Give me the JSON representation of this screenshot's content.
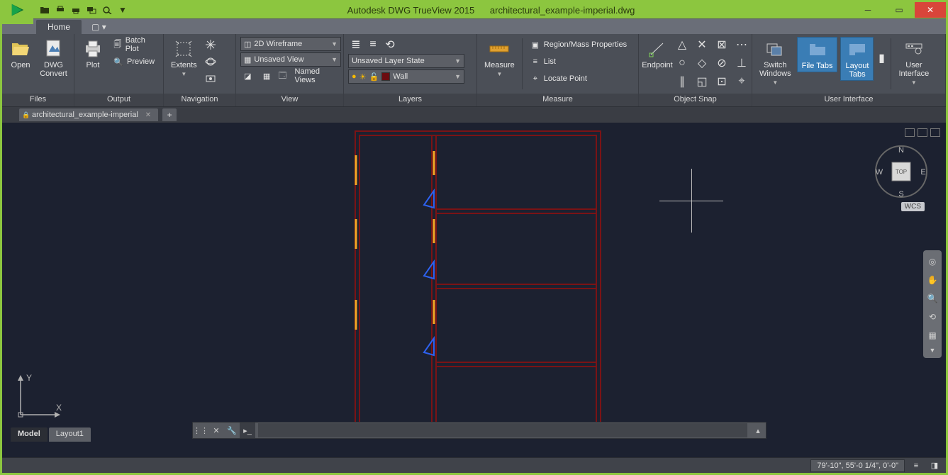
{
  "title": {
    "app": "Autodesk DWG TrueView 2015",
    "document": "architectural_example-imperial.dwg"
  },
  "tabs": {
    "home": "Home"
  },
  "panels": {
    "files": {
      "title": "Files",
      "open": "Open",
      "dwg_convert": "DWG\nConvert"
    },
    "output": {
      "title": "Output",
      "plot": "Plot",
      "batch_plot": "Batch Plot",
      "preview": "Preview"
    },
    "navigation": {
      "title": "Navigation",
      "extents": "Extents"
    },
    "view": {
      "title": "View",
      "visual_style": "2D Wireframe",
      "named_view": "Unsaved View",
      "named_views": "Named Views"
    },
    "layers": {
      "title": "Layers",
      "state": "Unsaved Layer State",
      "current": "Wall"
    },
    "measure": {
      "title": "Measure",
      "measure_btn": "Measure",
      "region": "Region/Mass Properties",
      "list": "List",
      "locate": "Locate Point"
    },
    "osnap": {
      "title": "Object Snap",
      "endpoint": "Endpoint"
    },
    "ui": {
      "title": "User Interface",
      "switch_windows": "Switch\nWindows",
      "file_tabs": "File Tabs",
      "layout_tabs": "Layout\nTabs",
      "user_interface": "User\nInterface"
    }
  },
  "file_tabs": {
    "active": "architectural_example-imperial"
  },
  "model_tabs": {
    "model": "Model",
    "layout1": "Layout1"
  },
  "viewcube": {
    "face": "TOP",
    "n": "N",
    "s": "S",
    "e": "E",
    "w": "W",
    "wcs": "WCS"
  },
  "status": {
    "coords": "79'-10\", 55'-0 1/4\", 0'-0\""
  },
  "ucs": {
    "x": "X",
    "y": "Y"
  }
}
